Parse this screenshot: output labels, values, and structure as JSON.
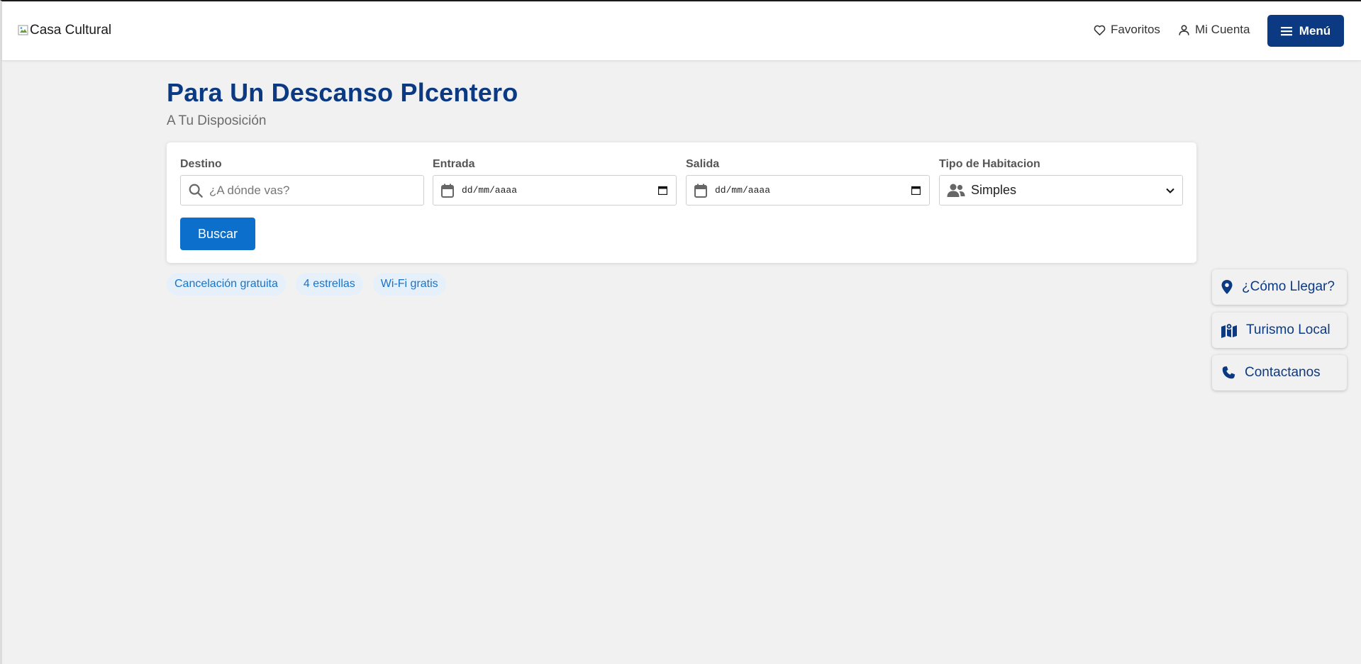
{
  "header": {
    "logo_alt": "Casa Cultural",
    "favorites_label": "Favoritos",
    "account_label": "Mi Cuenta",
    "menu_label": "Menú"
  },
  "hero": {
    "title": "Para Un Descanso Plcentero",
    "subtitle": "A Tu Disposición"
  },
  "search": {
    "destination_label": "Destino",
    "destination_placeholder": "¿A dónde vas?",
    "checkin_label": "Entrada",
    "checkin_value": "dd/mm/aaaa",
    "checkout_label": "Salida",
    "checkout_value": "dd/mm/aaaa",
    "room_type_label": "Tipo de Habitacion",
    "room_type_value": "Simples",
    "search_button": "Buscar"
  },
  "tags": [
    "Cancelación gratuita",
    "4 estrellas",
    "Wi-Fi gratis"
  ],
  "side_buttons": {
    "directions": "¿Cómo Llegar?",
    "tourism": "Turismo Local",
    "contact": "Contactanos"
  },
  "colors": {
    "brand_navy": "#0b3a83",
    "primary_blue": "#0b6fcb",
    "tag_bg": "#e6f0fb",
    "tag_text": "#1a73c5",
    "page_bg": "#f1f1f1"
  },
  "icons": {
    "favorites": "heart-icon",
    "account": "user-icon",
    "menu": "hamburger-icon",
    "destination": "search-icon",
    "dates": "calendar-icon",
    "room_type": "users-icon",
    "directions": "map-pin-icon",
    "tourism": "map-icon",
    "contact": "phone-icon"
  }
}
